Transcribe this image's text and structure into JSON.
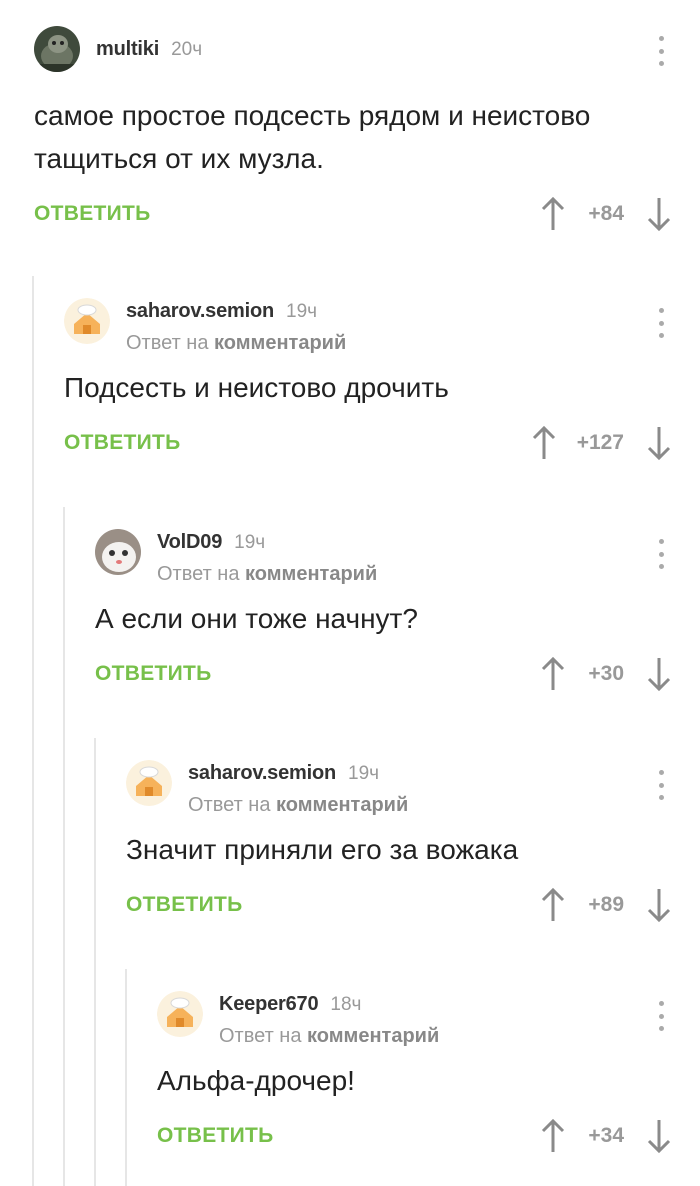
{
  "labels": {
    "reply": "ОТВЕТИТЬ",
    "reply_to_prefix": "Ответ на",
    "reply_to_link": "комментарий"
  },
  "comments": [
    {
      "author": "multiki",
      "time": "20ч",
      "text": "самое простое подсесть рядом и неистово тащиться от их музла.",
      "rating": "+84",
      "avatar_icon": "animal-photo-avatar"
    },
    {
      "author": "saharov.semion",
      "time": "19ч",
      "text": "Подсесть и неистово дрочить",
      "rating": "+127",
      "avatar_icon": "default-house-avatar"
    },
    {
      "author": "VolD09",
      "time": "19ч",
      "text": "А если они тоже начнут?",
      "rating": "+30",
      "avatar_icon": "white-cat-avatar"
    },
    {
      "author": "saharov.semion",
      "time": "19ч",
      "text": "Значит приняли его за вожака",
      "rating": "+89",
      "avatar_icon": "default-house-avatar"
    },
    {
      "author": "Keeper670",
      "time": "18ч",
      "text": "Альфа-дрочер!",
      "rating": "+34",
      "avatar_icon": "default-house-avatar"
    }
  ],
  "colors": {
    "reply_green": "#77c04a",
    "muted": "#999999",
    "thread_line": "#e6e6e6"
  }
}
